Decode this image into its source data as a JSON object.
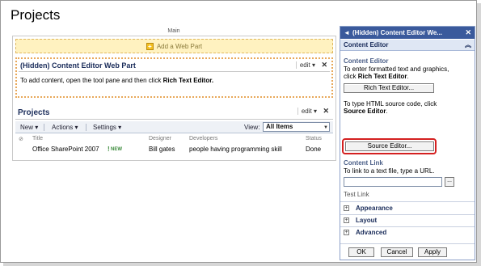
{
  "page": {
    "title": "Projects",
    "zone_label": "Main"
  },
  "add_web_part": {
    "label": "Add a Web Part"
  },
  "cewp": {
    "title": "(Hidden) Content Editor Web Part",
    "edit_label": "edit ▾",
    "close_label": "✕",
    "body_prefix": "To add content, open the tool pane and then click ",
    "body_bold": "Rich Text Editor."
  },
  "projects_part": {
    "title": "Projects",
    "edit_label": "edit ▾",
    "close_label": "✕",
    "toolbar": {
      "new_label": "New ▾",
      "actions_label": "Actions ▾",
      "settings_label": "Settings ▾"
    },
    "view": {
      "label": "View:",
      "selected": "All Items"
    },
    "columns": {
      "title": "Title",
      "designer": "Designer",
      "developers": "Developers",
      "status": "Status"
    },
    "rows": [
      {
        "title": "Office SharePoint 2007",
        "new_mark": "!",
        "new_badge": "NEW",
        "designer": "Bill gates",
        "developers": "people having programming skill",
        "status": "Done"
      }
    ]
  },
  "tool_pane": {
    "title": "(Hidden) Content Editor We...",
    "back_icon": "◄",
    "close_icon": "✕",
    "section_header": "Content Editor",
    "content_editor": {
      "title": "Content Editor",
      "text1_a": "To enter formatted text and graphics,",
      "text1_b": "click ",
      "text1_bold": "Rich Text Editor",
      "rich_text_button": "Rich Text Editor...",
      "text2_a": "To type HTML source code, click",
      "text2_bold": "Source Editor",
      "source_editor_button": "Source Editor..."
    },
    "content_link": {
      "title": "Content Link",
      "text": "To link to a text file, type a URL.",
      "browse_label": "...",
      "test_link": "Test Link"
    },
    "expanders": [
      "Appearance",
      "Layout",
      "Advanced"
    ],
    "footer": {
      "ok": "OK",
      "cancel": "Cancel",
      "apply": "Apply"
    }
  }
}
